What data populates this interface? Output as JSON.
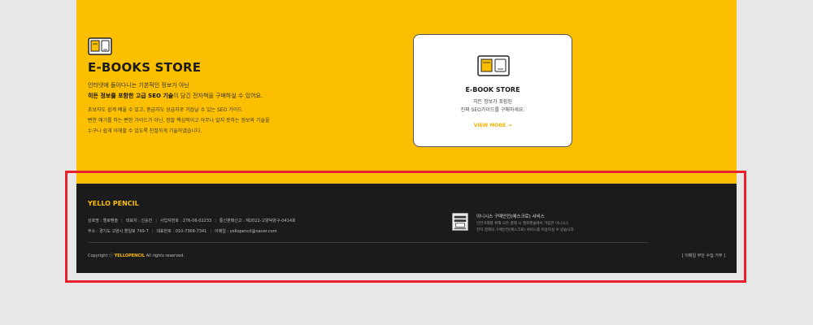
{
  "hero": {
    "title": "E-BOOKS STORE",
    "line1": "인터넷에 돌아다니는 기본적인 정보가 아닌",
    "line2_bold": "히든 정보를 포함한 고급 SEO 기술",
    "line2_rest": "이 담긴 전자책을 구매하실 수 있어요.",
    "line3": "초보자도 쉽게 배울 수 있고, 중급자도 상급자로 거듭날 수 있는 SEO 가이드",
    "line4": "뻔한 얘기를 하는 뻔한 가이드가 아닌, 정말 핵심적이고 아무나 알지 못하는 정보와 기술을",
    "line5": "누구나 쉽게 이해할 수 있도록 친절하게 기술하였습니다."
  },
  "card": {
    "title": "E-BOOK STORE",
    "line1": "히든 정보가 포함된",
    "line2": "진짜 SEO가이드를 구매하세요.",
    "link": "VIEW MORE →"
  },
  "footer": {
    "brand": "YELLO PENCIL",
    "info_row1": [
      "상호명 : 옐로펜슬",
      "대표자 : 신승진",
      "사업자번호 : 276-06-02233",
      "통신판매신고 : 제2022-고양덕양구-0414호"
    ],
    "info_row2": [
      "주소 : 경기도 고양시 할일로 749-7",
      "대표번호 : 010-7368-7341",
      "이메일 : yellopencil@naver.com"
    ],
    "escrow": {
      "title": "이니시스 구매안전(에스크로) 서비스",
      "desc1": "안전거래를 위해 모든 결제 시 옐로펜슬에서 가입한 이니시스",
      "desc2": "전자 결제의 구매안전(에스크로) 서비스를 이용하실 수 있습니다."
    },
    "copyright_prefix": "Copyright ⓒ",
    "copyright_brand": "YELLOPENCIL",
    "copyright_suffix": "All rights reserved.",
    "email_refuse": "[ 이메일 무단 수집 거부 ]"
  }
}
